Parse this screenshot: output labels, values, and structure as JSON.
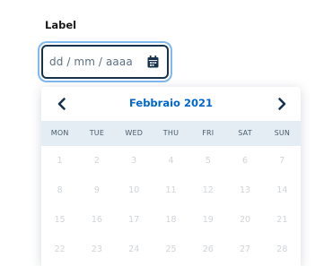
{
  "field": {
    "label": "Label",
    "placeholder": "dd / mm / aaaa"
  },
  "calendar": {
    "prev_icon": "chevron-left-icon",
    "next_icon": "chevron-right-icon",
    "month_title": "Febbraio 2021",
    "weekdays": [
      "MON",
      "TUE",
      "WED",
      "THU",
      "FRI",
      "SAT",
      "SUN"
    ],
    "weeks": [
      [
        "1",
        "2",
        "3",
        "4",
        "5",
        "6",
        "7"
      ],
      [
        "8",
        "9",
        "10",
        "11",
        "12",
        "13",
        "14"
      ],
      [
        "15",
        "16",
        "17",
        "18",
        "19",
        "20",
        "21"
      ],
      [
        "22",
        "23",
        "24",
        "25",
        "26",
        "27",
        "28"
      ]
    ]
  },
  "colors": {
    "accent": "#0066cc",
    "input_border": "#17324d",
    "focus_ring": "#7fb9ee",
    "weekday_band": "#e3edf3",
    "disabled_day": "#d0d4d8"
  }
}
